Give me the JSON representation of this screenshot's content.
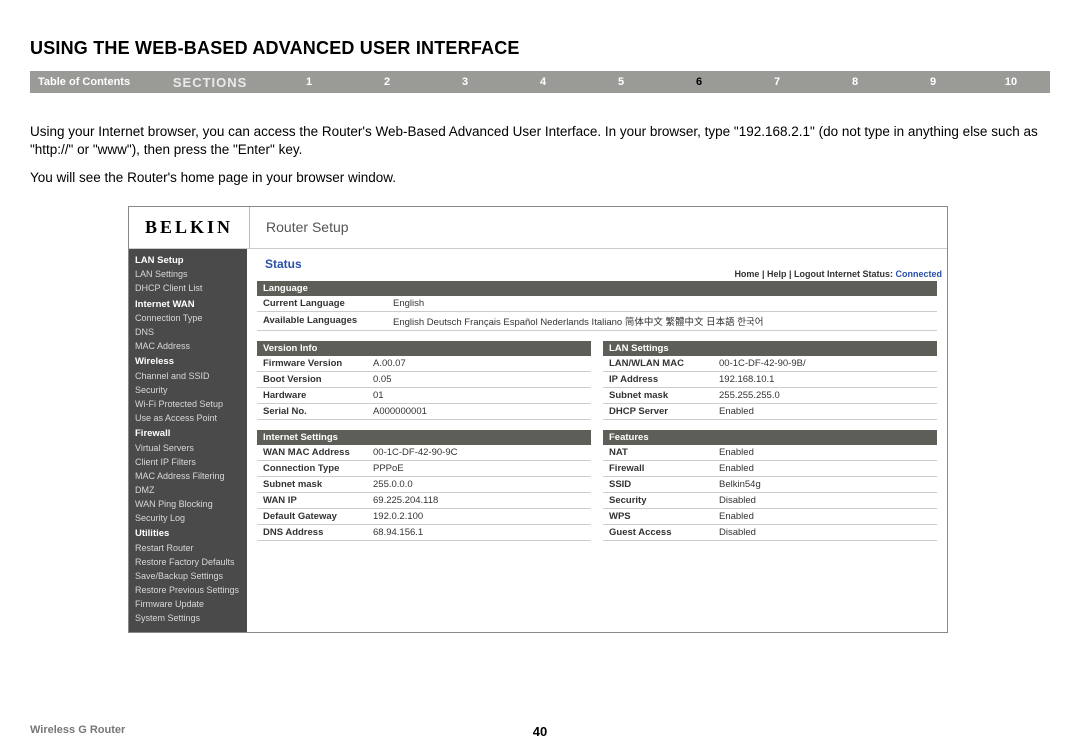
{
  "page": {
    "title": "USING THE WEB-BASED ADVANCED USER INTERFACE",
    "toc_label": "Table of Contents",
    "sections_label": "SECTIONS",
    "section_numbers": [
      "1",
      "2",
      "3",
      "4",
      "5",
      "6",
      "7",
      "8",
      "9",
      "10"
    ],
    "active_section": "6",
    "para1": "Using your Internet browser, you can access the Router's Web-Based Advanced User Interface. In your browser, type \"192.168.2.1\" (do not type in anything else such as \"http://\" or \"www\"), then press the \"Enter\" key.",
    "para2": "You will see the Router's home page in your browser window.",
    "footer_left": "Wireless G Router",
    "footer_page": "40"
  },
  "router": {
    "logo": "BELKIN",
    "setup_label": "Router Setup",
    "top_links": "Home | Help | Logout   Internet Status: ",
    "status_word": "Connected",
    "status_title": "Status",
    "sidebar": [
      {
        "type": "head",
        "label": "LAN Setup"
      },
      {
        "type": "item",
        "label": "LAN Settings"
      },
      {
        "type": "item",
        "label": "DHCP Client List"
      },
      {
        "type": "head",
        "label": "Internet WAN"
      },
      {
        "type": "item",
        "label": "Connection Type"
      },
      {
        "type": "item",
        "label": "DNS"
      },
      {
        "type": "item",
        "label": "MAC Address"
      },
      {
        "type": "head",
        "label": "Wireless"
      },
      {
        "type": "item",
        "label": "Channel and SSID"
      },
      {
        "type": "item",
        "label": "Security"
      },
      {
        "type": "item",
        "label": "Wi-Fi Protected Setup"
      },
      {
        "type": "item",
        "label": "Use as Access Point"
      },
      {
        "type": "head",
        "label": "Firewall"
      },
      {
        "type": "item",
        "label": "Virtual Servers"
      },
      {
        "type": "item",
        "label": "Client IP Filters"
      },
      {
        "type": "item",
        "label": "MAC Address Filtering"
      },
      {
        "type": "item",
        "label": "DMZ"
      },
      {
        "type": "item",
        "label": "WAN Ping Blocking"
      },
      {
        "type": "item",
        "label": "Security Log"
      },
      {
        "type": "head",
        "label": "Utilities"
      },
      {
        "type": "item",
        "label": "Restart Router"
      },
      {
        "type": "item",
        "label": "Restore Factory Defaults"
      },
      {
        "type": "item",
        "label": "Save/Backup Settings"
      },
      {
        "type": "item",
        "label": "Restore Previous Settings"
      },
      {
        "type": "item",
        "label": "Firmware Update"
      },
      {
        "type": "item",
        "label": "System Settings"
      }
    ],
    "language": {
      "header": "Language",
      "rows": [
        {
          "label": "Current Language",
          "value": "English"
        },
        {
          "label": "Available Languages",
          "value": "English  Deutsch  Français  Español  Nederlands  Italiano  简体中文  繁體中文  日本語  한국어"
        }
      ]
    },
    "version": {
      "header": "Version Info",
      "rows": [
        {
          "label": "Firmware Version",
          "value": "A.00.07"
        },
        {
          "label": "Boot Version",
          "value": "0.05"
        },
        {
          "label": "Hardware",
          "value": "01"
        },
        {
          "label": "Serial No.",
          "value": "A000000001"
        }
      ]
    },
    "lan": {
      "header": "LAN Settings",
      "rows": [
        {
          "label": "LAN/WLAN MAC",
          "value": "00-1C-DF-42-90-9B/"
        },
        {
          "label": "IP Address",
          "value": "192.168.10.1"
        },
        {
          "label": "Subnet mask",
          "value": "255.255.255.0"
        },
        {
          "label": "DHCP Server",
          "value": "Enabled"
        }
      ]
    },
    "internet": {
      "header": "Internet Settings",
      "rows": [
        {
          "label": "WAN MAC Address",
          "value": "00-1C-DF-42-90-9C"
        },
        {
          "label": "Connection Type",
          "value": "PPPoE"
        },
        {
          "label": "Subnet mask",
          "value": "255.0.0.0"
        },
        {
          "label": "WAN IP",
          "value": "69.225.204.118"
        },
        {
          "label": "Default Gateway",
          "value": "192.0.2.100"
        },
        {
          "label": "DNS Address",
          "value": "68.94.156.1"
        }
      ]
    },
    "features": {
      "header": "Features",
      "rows": [
        {
          "label": "NAT",
          "value": "Enabled"
        },
        {
          "label": "Firewall",
          "value": "Enabled"
        },
        {
          "label": "SSID",
          "value": "Belkin54g"
        },
        {
          "label": "Security",
          "value": "Disabled"
        },
        {
          "label": "WPS",
          "value": "Enabled"
        },
        {
          "label": "Guest Access",
          "value": "Disabled"
        }
      ]
    }
  }
}
